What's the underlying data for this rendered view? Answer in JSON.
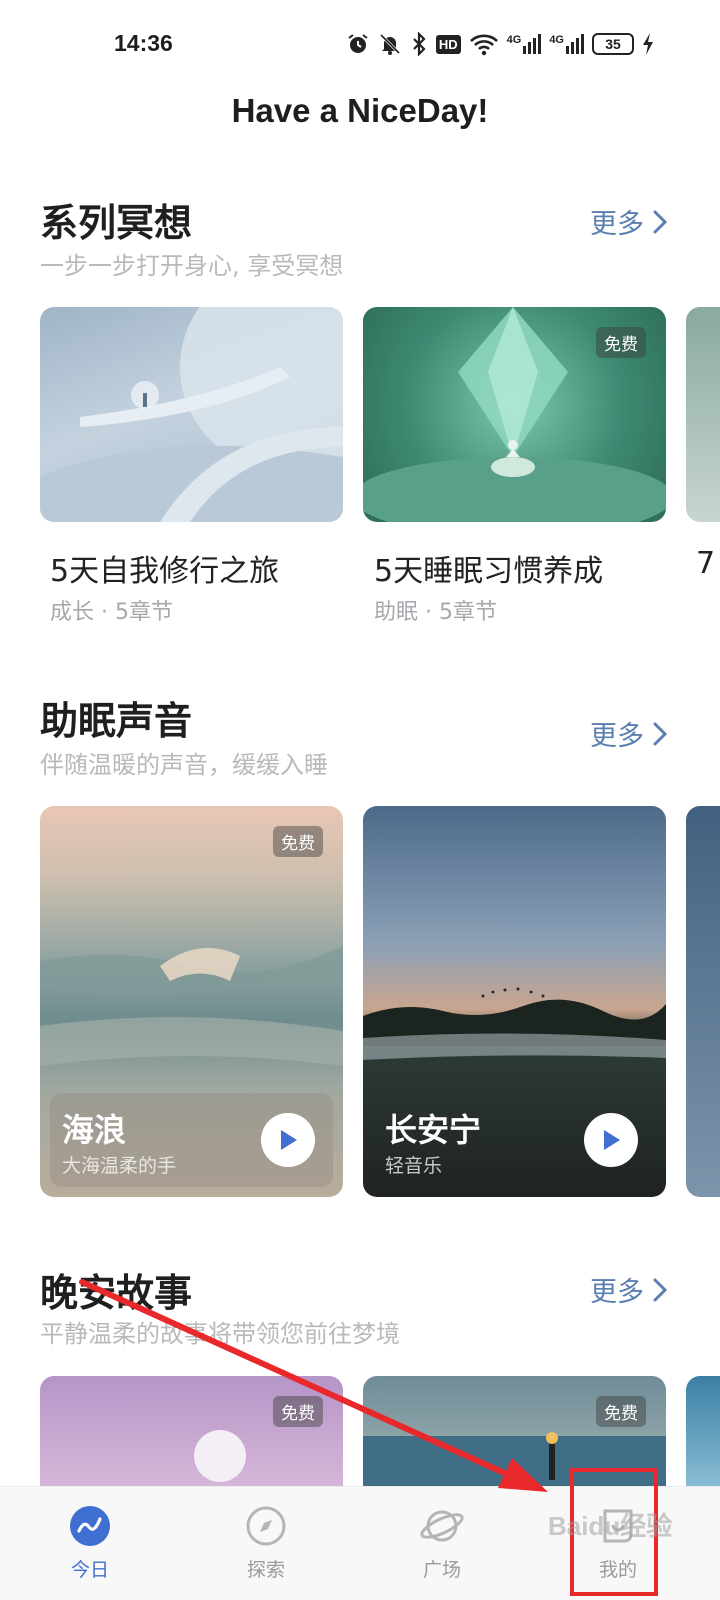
{
  "status_bar": {
    "time": "14:36",
    "icons": [
      "alarm-icon",
      "mute-icon",
      "bluetooth-icon",
      "hd-icon",
      "wifi-icon",
      "signal-4g-icon",
      "signal-4g-icon"
    ],
    "hd_label": "HD",
    "signal_label": "4G",
    "battery": "35"
  },
  "app_title": "Have a NiceDay!",
  "more_label": "更多",
  "sections": {
    "series": {
      "title": "系列冥想",
      "subtitle": "一步一步打开身心, 享受冥想",
      "cards": [
        {
          "title": "5天自我修行之旅",
          "meta": "成长 · 5章节",
          "badge": ""
        },
        {
          "title": "5天睡眠习惯养成",
          "meta": "助眠 · 5章节",
          "badge": "免费"
        }
      ]
    },
    "sleep_sounds": {
      "title": "助眠声音",
      "subtitle": "伴随温暖的声音，缓缓入睡",
      "cards": [
        {
          "title": "海浪",
          "meta": "大海温柔的手",
          "badge": "免费"
        },
        {
          "title": "长安宁",
          "meta": "轻音乐",
          "badge": ""
        }
      ]
    },
    "stories": {
      "title": "晚安故事",
      "subtitle": "平静温柔的故事将带领您前往梦境",
      "cards": [
        {
          "badge": "免费"
        },
        {
          "badge": "免费"
        }
      ]
    }
  },
  "bottom_nav": [
    {
      "label": "今日",
      "icon": "today-icon",
      "active": true
    },
    {
      "label": "探索",
      "icon": "compass-icon",
      "active": false
    },
    {
      "label": "广场",
      "icon": "planet-icon",
      "active": false
    },
    {
      "label": "我的",
      "icon": "profile-icon",
      "active": false
    }
  ],
  "colors": {
    "accent": "#3f6fd0",
    "more_link": "#5a7fb0",
    "annotation_red": "#e8282b"
  },
  "watermark": "Baidu经验"
}
